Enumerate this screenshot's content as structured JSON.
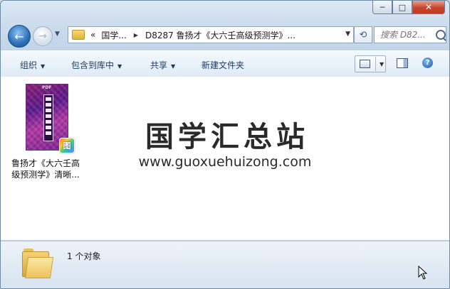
{
  "window": {
    "caption_buttons": {
      "minimize": "─",
      "maximize": "□",
      "close": "✕"
    }
  },
  "nav": {
    "back_glyph": "←",
    "forward_glyph": "→",
    "address": {
      "overflow": "«",
      "crumbs": [
        "国学...",
        "D8287 鲁扬才《大六壬高级预测学》..."
      ]
    },
    "refresh_glyph": "⟲",
    "search": {
      "placeholder": "搜索 D82..."
    }
  },
  "toolbar": {
    "organize": "组织",
    "include_in_library": "包含到库中",
    "share": "共享",
    "new_folder": "新建文件夹",
    "help": "?"
  },
  "content": {
    "file": {
      "name_line1": "鲁扬才《大六壬高",
      "name_line2": "级预测学》清晰...",
      "thumb_label": "PDF",
      "badge": "图"
    },
    "watermark": {
      "title": "国学汇总站",
      "url": "www.guoxuehuizong.com"
    }
  },
  "details": {
    "count_text": "1 个对象"
  },
  "icons": [
    "folder-icon",
    "search-icon",
    "view-icon",
    "preview-pane-icon",
    "help-icon",
    "pdf-thumbnail-icon",
    "cursor-icon"
  ]
}
